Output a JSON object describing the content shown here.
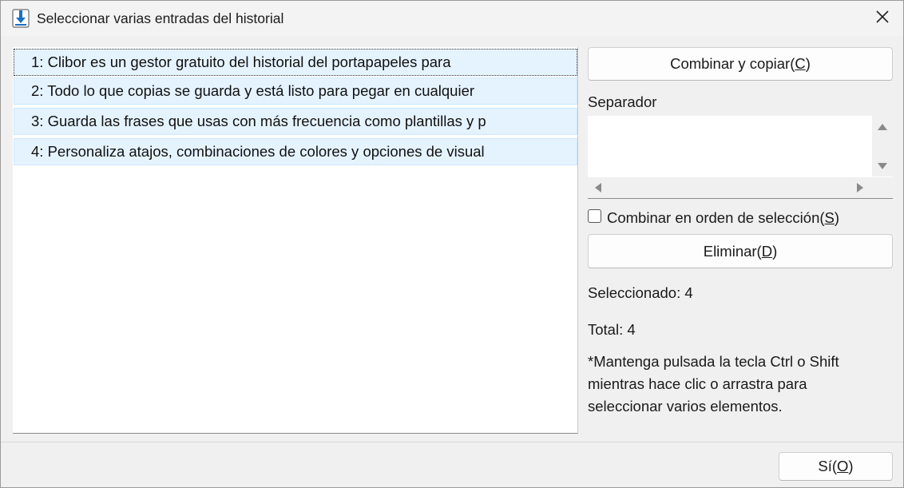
{
  "window": {
    "title": "Seleccionar varias entradas del historial"
  },
  "list": {
    "items": [
      "1: Clibor es un gestor gratuito del historial del portapapeles para",
      "2: Todo lo que copias se guarda y está listo para pegar en cualquier",
      "3: Guarda las frases que usas con más frecuencia como plantillas y p",
      "4: Personaliza atajos, combinaciones de colores y opciones de visual"
    ]
  },
  "actions": {
    "combine_copy": {
      "text": "Combinar y copiar(",
      "key": "C",
      "end": ")"
    },
    "separator_label": "Separador",
    "separator_value": "",
    "combine_order": {
      "text": "Combinar en orden de selección(",
      "key": "S",
      "end": ")",
      "checked": false
    },
    "delete": {
      "text": "Eliminar(",
      "key": "D",
      "end": ")"
    }
  },
  "status": {
    "selected": "Seleccionado: 4",
    "total": "Total: 4",
    "hint_lines": [
      "*Mantenga pulsada la tecla Ctrl o Shift",
      "mientras hace clic o arrastra para",
      "seleccionar varios elementos."
    ]
  },
  "footer": {
    "ok": {
      "text": "Sí(",
      "key": "O",
      "end": ")"
    }
  },
  "icons": {
    "app": "download-arrow-icon",
    "close": "close-icon"
  },
  "colors": {
    "selection_bg": "#e5f3ff",
    "accent": "#1a6fc4"
  }
}
